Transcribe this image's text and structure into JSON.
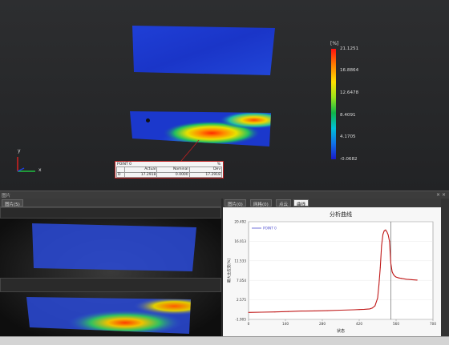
{
  "legend": {
    "unit": "[%]",
    "ticks": [
      "21.1251",
      "16.8864",
      "12.6478",
      "8.4091",
      "4.1705",
      "-0.0682"
    ]
  },
  "axes": {
    "y": "y",
    "x": "x"
  },
  "point_table": {
    "title": "POINT 0",
    "unit": "%",
    "headers": [
      "",
      "Actual",
      "Nominal",
      "Dev"
    ],
    "row": [
      "D",
      "17.2918",
      "0.0000",
      "17.2918"
    ]
  },
  "divider": {
    "label": "图片",
    "close": "× ×"
  },
  "left_panel": {
    "tab": "图片(5)"
  },
  "right_panel": {
    "tabs": [
      "图片(0)",
      "网格(0)",
      "点云",
      "曲线"
    ],
    "active_tab": 3
  },
  "chart_data": {
    "type": "line",
    "title": "分析曲线",
    "xlabel": "状态",
    "ylabel": "最大主应变[%]",
    "xlim": [
      0,
      700
    ],
    "ylim": [
      -1.905,
      20.492
    ],
    "yticks": [
      "20.492",
      "16.013",
      "11.533",
      "7.054",
      "2.575",
      "-1.905"
    ],
    "xticks": [
      "0",
      "140",
      "280",
      "420",
      "560",
      "700"
    ],
    "legend": "POINT 0",
    "marker_x": 540,
    "series": [
      {
        "name": "POINT 0",
        "color": "#c01818",
        "x": [
          0,
          50,
          100,
          150,
          200,
          250,
          300,
          350,
          400,
          420,
          440,
          460,
          470,
          480,
          490,
          495,
          500,
          505,
          510,
          515,
          520,
          525,
          530,
          535,
          540,
          545,
          550,
          555,
          560,
          570,
          580,
          600,
          620,
          640
        ],
        "y": [
          -0.3,
          -0.25,
          -0.2,
          -0.1,
          0.0,
          0.05,
          0.1,
          0.2,
          0.3,
          0.35,
          0.4,
          0.5,
          0.7,
          1.2,
          3.0,
          6.0,
          10.0,
          15.0,
          17.6,
          18.4,
          18.6,
          18.2,
          17.5,
          16.0,
          11.0,
          9.0,
          8.4,
          8.0,
          7.8,
          7.6,
          7.5,
          7.3,
          7.2,
          7.1
        ]
      }
    ]
  }
}
